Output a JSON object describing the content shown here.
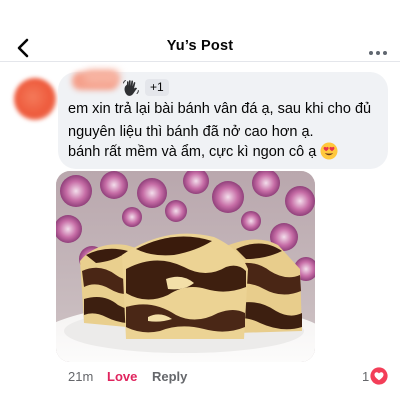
{
  "header": {
    "title": "Yu’s Post",
    "back_icon": "chevron-left-icon",
    "more_icon": "more-horizontal-icon"
  },
  "comment": {
    "reaction_badge": "+1",
    "badge_icon": "waving-hand-icon",
    "text_line1": "em xin trả lại bài bánh vân đá ạ, sau khi cho đủ nguyên liệu thì bánh đã nở cao hơn ạ.",
    "text_line2": "bánh rất mềm và ẩm, cực kì ngon cô ạ",
    "text_emoji": "heart-eyes-icon",
    "photo": "marble-cake-photo"
  },
  "meta": {
    "time": "21m",
    "love_label": "Love",
    "reply_label": "Reply",
    "reaction_count": "1",
    "reaction_icon": "heart-icon"
  },
  "colors": {
    "love": "#e0245e",
    "bubble": "#f0f2f5",
    "secondary_text": "#65676b"
  }
}
